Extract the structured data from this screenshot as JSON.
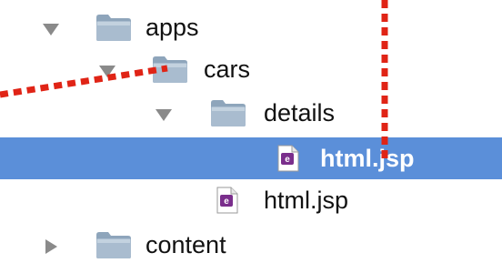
{
  "colors": {
    "selection": "#5b8fd9",
    "folder": "#9fb4c8",
    "annotation": "#e02416",
    "disclosure": "#8a8a8a"
  },
  "tree": {
    "items": [
      {
        "label": "apps",
        "icon": "folder-icon",
        "expanded": true,
        "selected": false
      },
      {
        "label": "cars",
        "icon": "folder-icon",
        "expanded": true,
        "selected": false
      },
      {
        "label": "details",
        "icon": "folder-icon",
        "expanded": true,
        "selected": false
      },
      {
        "label": "html.jsp",
        "icon": "jsp-file-icon",
        "selected": true
      },
      {
        "label": "html.jsp",
        "icon": "jsp-file-icon",
        "selected": false
      },
      {
        "label": "content",
        "icon": "folder-icon",
        "expanded": false,
        "selected": false
      }
    ]
  }
}
